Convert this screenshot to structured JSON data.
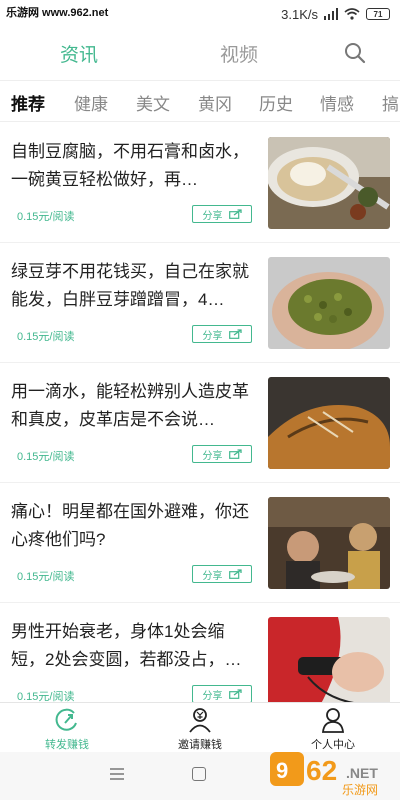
{
  "watermark": {
    "url": "乐游网 www.962.net"
  },
  "status_bar": {
    "speed": "3.1K/s",
    "battery": "71"
  },
  "top_tabs": [
    {
      "label": "资讯",
      "active": true
    },
    {
      "label": "视频",
      "active": false
    }
  ],
  "categories": [
    {
      "label": "推荐",
      "active": true
    },
    {
      "label": "健康"
    },
    {
      "label": "美文"
    },
    {
      "label": "黄冈"
    },
    {
      "label": "历史"
    },
    {
      "label": "情感"
    },
    {
      "label": "搞"
    }
  ],
  "articles": [
    {
      "title": "自制豆腐脑，不用石膏和卤水，一碗黄豆轻松做好，再…",
      "price": "0.15元/阅读",
      "share": "分享",
      "thumb": "tofu"
    },
    {
      "title": "绿豆芽不用花钱买，自己在家就能发，白胖豆芽蹭蹭冒，4…",
      "price": "0.15元/阅读",
      "share": "分享",
      "thumb": "mung-beans"
    },
    {
      "title": "用一滴水，能轻松辨别人造皮革和真皮，皮革店是不会说…",
      "price": "0.15元/阅读",
      "share": "分享",
      "thumb": "leather-shoe"
    },
    {
      "title": "痛心！明星都在国外避难，你还心疼他们吗?",
      "price": "0.15元/阅读",
      "share": "分享",
      "thumb": "restaurant"
    },
    {
      "title": "男性开始衰老，身体1处会缩短，2处会变圆，若都没占，…",
      "price": "0.15元/阅读",
      "share": "分享",
      "thumb": "hands"
    }
  ],
  "bottom_nav": [
    {
      "label": "转发赚钱",
      "icon": "share-earn-icon",
      "active": true
    },
    {
      "label": "邀请赚钱",
      "icon": "invite-earn-icon",
      "active": false
    },
    {
      "label": "个人中心",
      "icon": "user-center-icon",
      "active": false
    }
  ],
  "logo": {
    "text": "962",
    "sub": "乐游网"
  },
  "colors": {
    "accent": "#43b88f",
    "text": "#222222",
    "muted": "#888888"
  }
}
